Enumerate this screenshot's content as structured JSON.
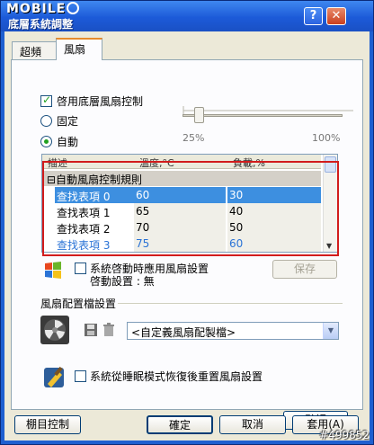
{
  "window": {
    "brand": "MOBILE",
    "title": "底層系統調整",
    "help_label": "?",
    "close_label": "✕"
  },
  "tabs": [
    {
      "label": "超頻"
    },
    {
      "label": "風扇"
    }
  ],
  "fan": {
    "enable_label": "啓用底層風扇控制",
    "fixed_label": "固定",
    "auto_label": "自動",
    "slider_min_label": "25%",
    "slider_max_label": "100%",
    "slider_level": 0.1,
    "grid": {
      "headers": [
        "描述",
        "溫度,°C",
        "負載,%"
      ],
      "group_label": "⊟自動風扇控制規則",
      "rows": [
        {
          "desc": "查找表項 0",
          "temp": "60",
          "load": "30",
          "selected": true
        },
        {
          "desc": "查找表項 1",
          "temp": "65",
          "load": "40",
          "selected": false
        },
        {
          "desc": "查找表項 2",
          "temp": "70",
          "load": "50",
          "selected": false
        },
        {
          "desc": "查找表項 3",
          "temp": "75",
          "load": "60",
          "selected": false
        }
      ]
    },
    "apply_on_startup_label": "系統啓動時應用風扇設置",
    "startup_setting_label": "啓動設置 : 無",
    "save_label": "保存",
    "profile_section_label": "風扇配置檔設置",
    "profile_select_value": "<自定義風扇配製檔>",
    "reset_on_resume_label": "系統從睡眠模式恢復後重置風扇設置",
    "default_label": "默認"
  },
  "footer": {
    "bottom_control_label": "棚目控制",
    "ok_label": "確定",
    "cancel_label": "取消",
    "apply_label": "套用(A)"
  },
  "watermark": "#499852",
  "colors": {
    "titlebar": "#1c5ad8",
    "selection": "#3d8fe0",
    "outline": "#d21c1c"
  }
}
